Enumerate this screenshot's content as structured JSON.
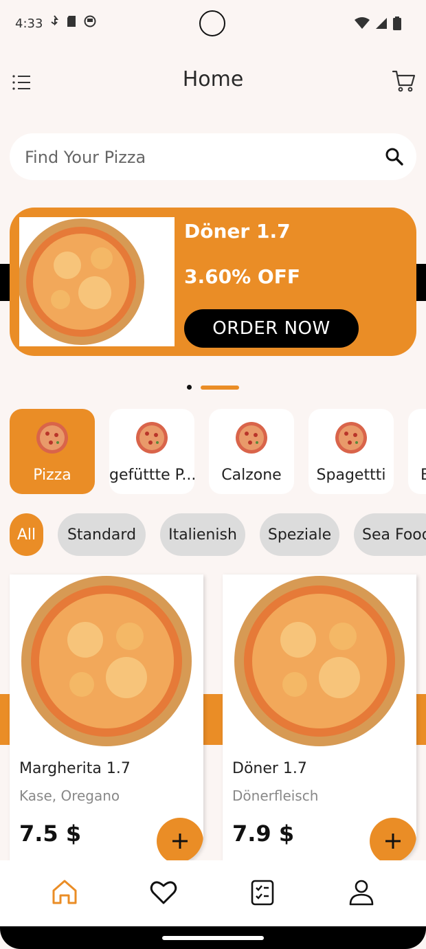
{
  "status": {
    "time": "4:33"
  },
  "header": {
    "title": "Home"
  },
  "search": {
    "placeholder": "Find Your Pizza"
  },
  "promo": {
    "title": "Döner 1.7",
    "discount": "3.60% OFF",
    "button": "ORDER NOW"
  },
  "categories": [
    {
      "label": "Pizza",
      "active": true
    },
    {
      "label": "gefüttte P...",
      "active": false
    },
    {
      "label": "Calzone",
      "active": false
    },
    {
      "label": "Spagettti",
      "active": false
    },
    {
      "label": "B",
      "active": false
    }
  ],
  "chips": [
    {
      "label": "All",
      "active": true
    },
    {
      "label": "Standard",
      "active": false
    },
    {
      "label": "Italienish",
      "active": false
    },
    {
      "label": "Speziale",
      "active": false
    },
    {
      "label": "Sea Food",
      "active": false
    }
  ],
  "products": [
    {
      "name": "Margherita 1.7",
      "desc": "Kase, Oregano",
      "price": "7.5 $"
    },
    {
      "name": "Döner 1.7",
      "desc": "Dönerfleisch",
      "price": "7.9 $"
    }
  ],
  "nav": [
    "home-icon",
    "heart-icon",
    "orders-icon",
    "profile-icon"
  ],
  "colors": {
    "accent": "#ea8d26",
    "background": "#fbf5f3",
    "dark": "#000000"
  }
}
